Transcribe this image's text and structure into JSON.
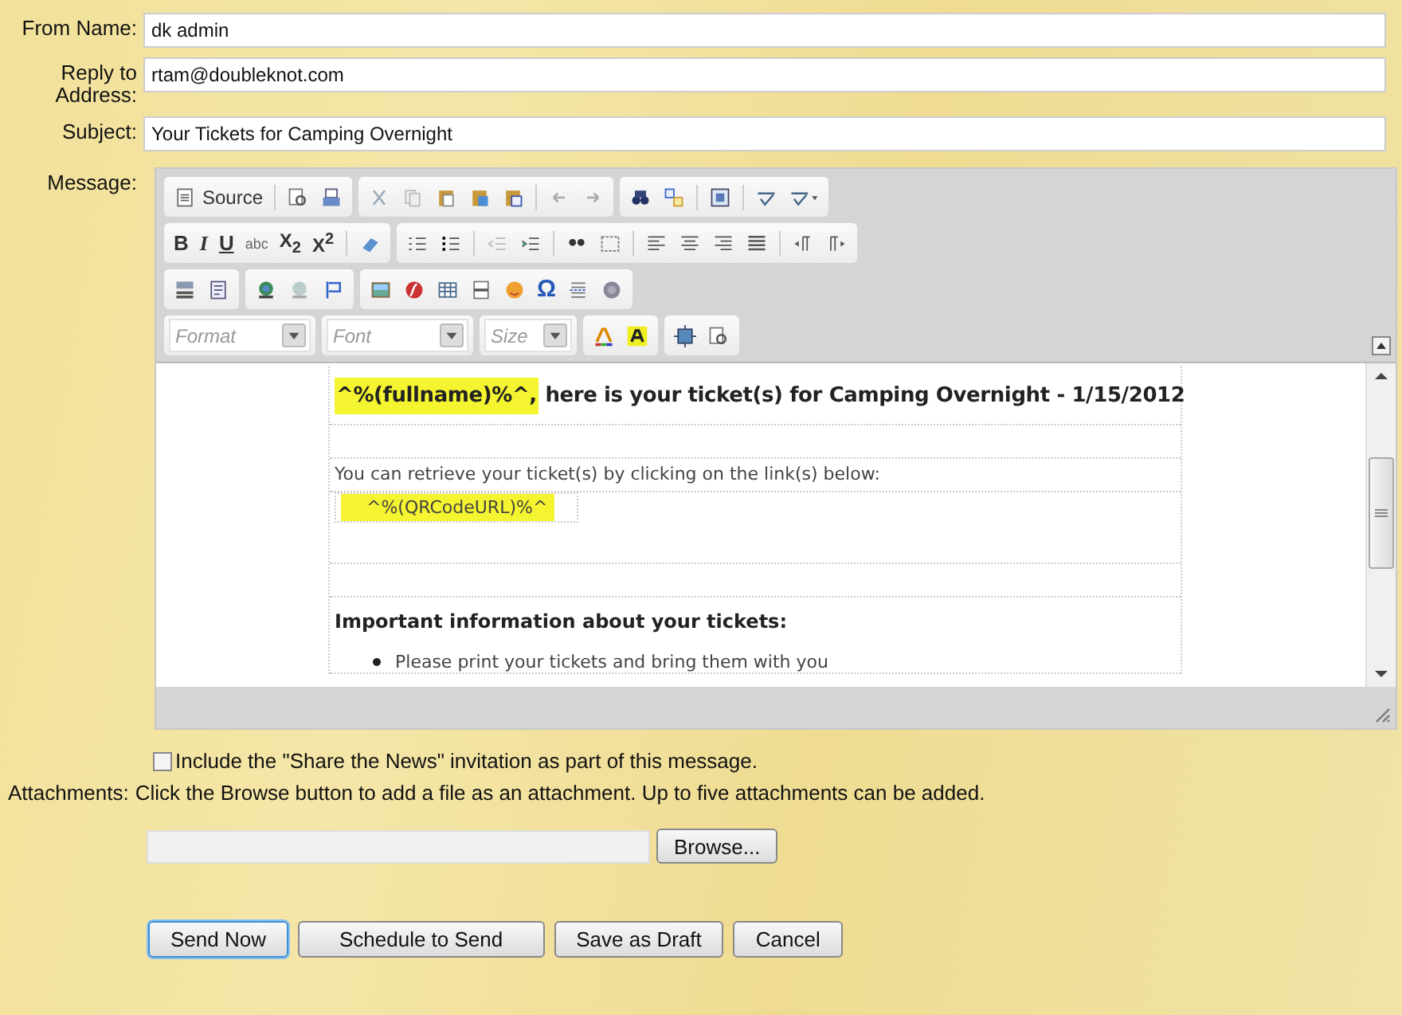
{
  "form": {
    "fields": [
      {
        "label": "From Name:",
        "value": "dk admin"
      },
      {
        "label": "Reply to Address:",
        "value": "rtam@doubleknot.com"
      },
      {
        "label": "Subject:",
        "value": "Your Tickets for Camping Overnight"
      }
    ],
    "message_label": "Message:"
  },
  "editor": {
    "toolbar_labels": [
      "Source",
      "B",
      "I",
      "U",
      "abc",
      "X$_{2}$",
      "X$^{2}$",
      "Ω"
    ],
    "combos": [
      {
        "placeholder": "Format"
      },
      {
        "placeholder": "Font"
      },
      {
        "placeholder": "Size"
      }
    ],
    "content": {
      "heading_highlight": "^%(fullname)%^,",
      "heading_rest": " here is your ticket(s) for Camping Overnight - 1/15/2012",
      "intro": "You can retrieve your ticket(s) by clicking on the link(s) below:",
      "link_token": "^%(QRCodeURL)%^",
      "info_heading": "Important information about your tickets:",
      "bullets": [
        "Please print your tickets and bring them with you"
      ]
    }
  },
  "share_news": {
    "label": "Include the \"Share the News\" invitation as part of this message.",
    "checked": false
  },
  "attachments": {
    "label": "Attachments:",
    "hint": "Click the Browse button to add a file as an attachment. Up to five attachments can be added.",
    "browse": "Browse..."
  },
  "buttons": [
    {
      "label": "Send Now",
      "focused": true
    },
    {
      "label": "Schedule to Send",
      "focused": false
    },
    {
      "label": "Save as Draft",
      "focused": false
    },
    {
      "label": "Cancel",
      "focused": false
    }
  ]
}
